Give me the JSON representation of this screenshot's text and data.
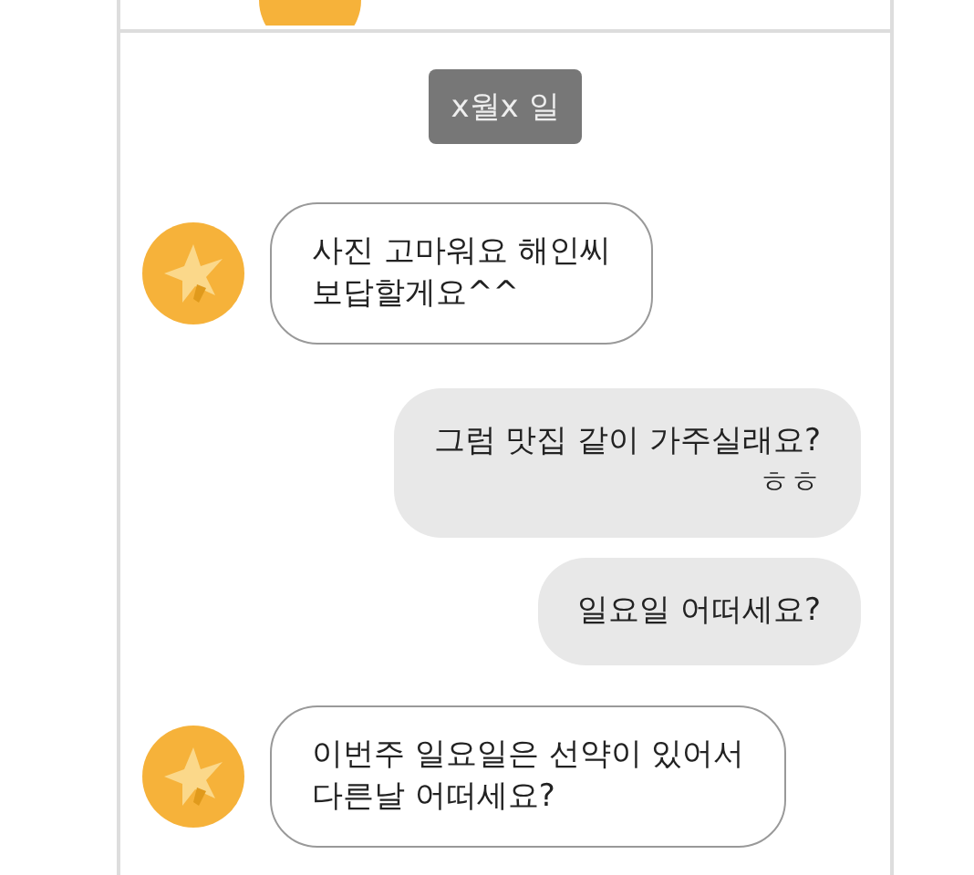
{
  "date_label": "x월x 일",
  "messages": [
    {
      "kind": "received",
      "text": "사진 고마워요 해인씨\n보답할게요^^"
    },
    {
      "kind": "sent",
      "text": "그럼 맛집 같이 가주실래요?\nㅎㅎ"
    },
    {
      "kind": "sent",
      "text": "일요일 어떠세요?"
    },
    {
      "kind": "received",
      "text": "이번주 일요일은 선약이 있어서\n다른날 어떠세요?"
    }
  ]
}
